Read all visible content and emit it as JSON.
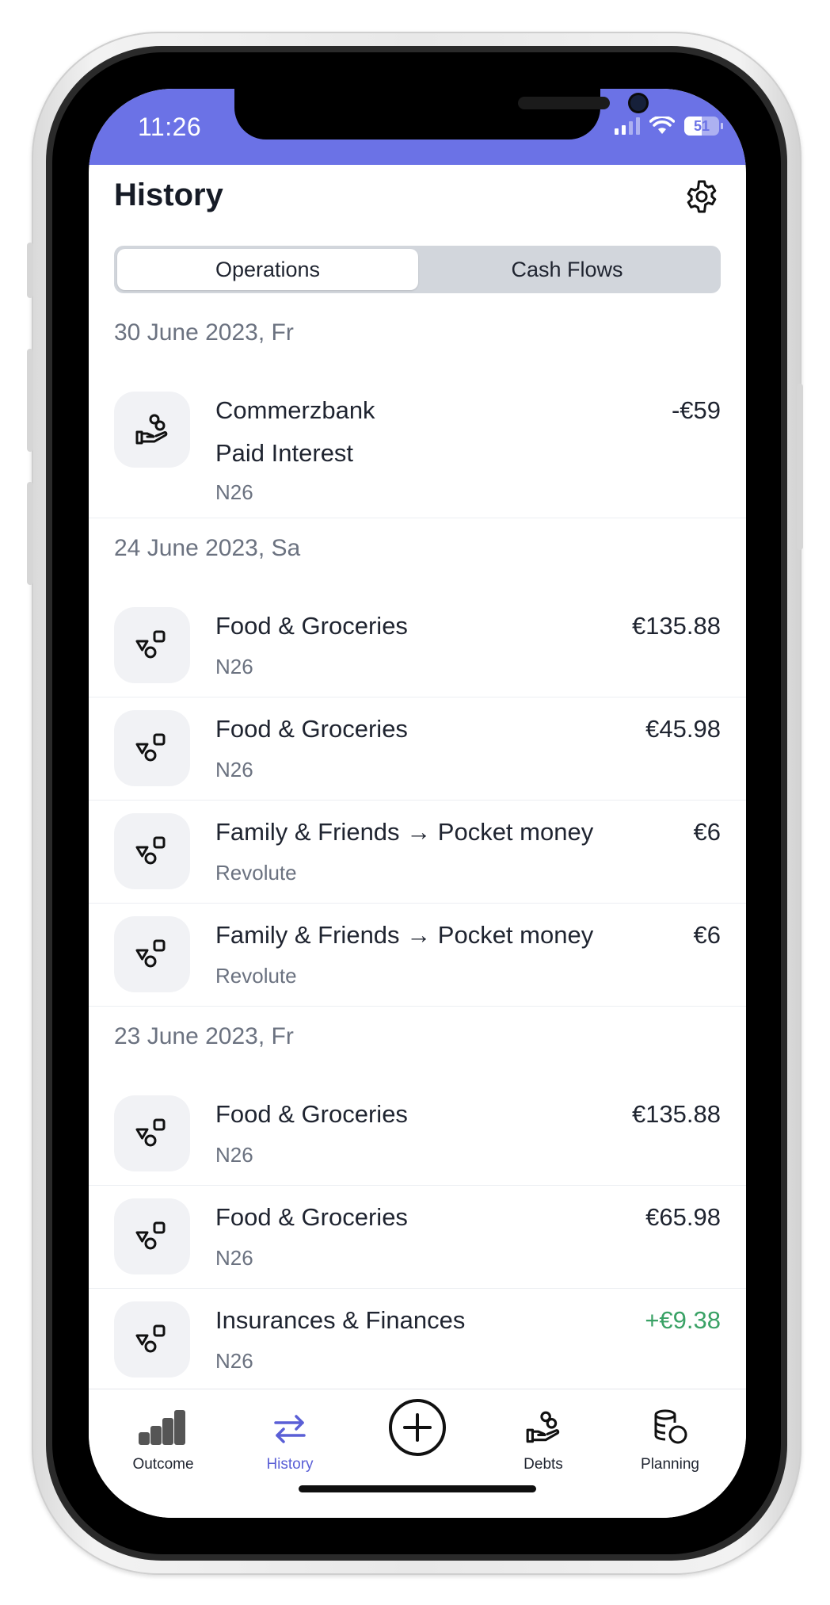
{
  "status_bar": {
    "time": "11:26",
    "battery": "51"
  },
  "header": {
    "title": "History"
  },
  "segmented_control": {
    "options": [
      "Operations",
      "Cash Flows"
    ],
    "selected": "Operations"
  },
  "groups": [
    {
      "date": "30 June 2023, Fr",
      "items": [
        {
          "title": "Commerzbank",
          "subtitle": "Paid Interest",
          "account": "N26",
          "amount": "-€59",
          "icon": "hand-coins-icon"
        }
      ]
    },
    {
      "date": "24 June 2023, Sa",
      "items": [
        {
          "title": "Food & Groceries",
          "account": "N26",
          "amount": "€135.88",
          "icon": "shapes-icon"
        },
        {
          "title": "Food & Groceries",
          "account": "N26",
          "amount": "€45.98",
          "icon": "shapes-icon"
        },
        {
          "title": "Family & Friends → Pocket money",
          "account": "Revolute",
          "amount": "€6",
          "icon": "shapes-icon"
        },
        {
          "title": "Family & Friends → Pocket money",
          "account": "Revolute",
          "amount": "€6",
          "icon": "shapes-icon"
        }
      ]
    },
    {
      "date": "23 June 2023, Fr",
      "items": [
        {
          "title": "Food & Groceries",
          "account": "N26",
          "amount": "€135.88",
          "icon": "shapes-icon"
        },
        {
          "title": "Food & Groceries",
          "account": "N26",
          "amount": "€65.98",
          "icon": "shapes-icon"
        },
        {
          "title": "Insurances & Finances",
          "account": "N26",
          "amount": "+€9.38",
          "icon": "shapes-icon",
          "positive": true
        }
      ]
    }
  ],
  "tabbar": {
    "items": [
      {
        "label": "Outcome",
        "icon": "bar-chart-icon"
      },
      {
        "label": "History",
        "icon": "transfer-arrows-icon",
        "active": true
      },
      {
        "label": "",
        "icon": "add-circle-icon"
      },
      {
        "label": "Debts",
        "icon": "hand-coins-icon"
      },
      {
        "label": "Planning",
        "icon": "coins-stack-icon"
      }
    ]
  },
  "colors": {
    "accent": "#6b72e6",
    "active_tab": "#5a5fd6",
    "positive": "#3aa266",
    "muted_text": "#6b7280"
  }
}
